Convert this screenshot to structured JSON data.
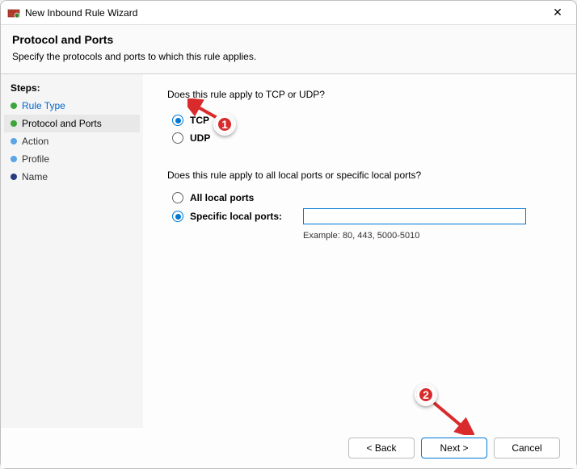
{
  "window": {
    "title": "New Inbound Rule Wizard",
    "close_glyph": "✕"
  },
  "header": {
    "title": "Protocol and Ports",
    "subtitle": "Specify the protocols and ports to which this rule applies."
  },
  "sidebar": {
    "header": "Steps:",
    "items": [
      {
        "label": "Rule Type",
        "state": "done"
      },
      {
        "label": "Protocol and Ports",
        "state": "current"
      },
      {
        "label": "Action",
        "state": "pending"
      },
      {
        "label": "Profile",
        "state": "pending"
      },
      {
        "label": "Name",
        "state": "pending"
      }
    ]
  },
  "content": {
    "protocol_question": "Does this rule apply to TCP or UDP?",
    "protocol_options": {
      "tcp": "TCP",
      "udp": "UDP",
      "selected": "tcp"
    },
    "ports_question": "Does this rule apply to all local ports or specific local ports?",
    "ports_options": {
      "all": "All local ports",
      "specific": "Specific local ports:",
      "selected": "specific",
      "input_value": "",
      "example": "Example: 80, 443, 5000-5010"
    }
  },
  "footer": {
    "back": "< Back",
    "next": "Next >",
    "cancel": "Cancel"
  },
  "annotations": {
    "callout1": "1",
    "callout2": "2"
  }
}
